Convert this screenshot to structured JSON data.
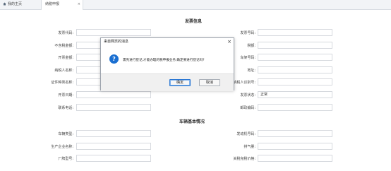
{
  "tabs": {
    "home_label": "我的主页",
    "active_label": "纳税申报",
    "close_label": "×"
  },
  "invoice": {
    "title": "发票信息",
    "left_labels": [
      "发票代码:",
      "不含税金额:",
      "开票金额:",
      "纳税人名称:",
      "证件种类名称:",
      "开票日期:",
      "联系电话:"
    ],
    "right_labels": [
      "发票号码:",
      "税额:",
      "车架号码:",
      "地址:",
      "纳税人识别号:",
      "发票状态:",
      "邮政编码:"
    ],
    "status_value": "正常"
  },
  "vehicle": {
    "title": "车辆基本情况",
    "left_labels": [
      "车辆类型:",
      "生产企业名称:",
      "厂牌型号:"
    ],
    "right_labels": [
      "发动机号码:",
      "排气量:",
      "关税完税价格:"
    ]
  },
  "dialog": {
    "title": "来自网页的消息",
    "close": "×",
    "message": "需先进行登记,才能办理的税申报业务,确定要进行登记吗?",
    "ok_label": "确定",
    "cancel_label": "取消",
    "icon": "question-icon"
  },
  "colors": {
    "accent": "#1a6fd1"
  }
}
